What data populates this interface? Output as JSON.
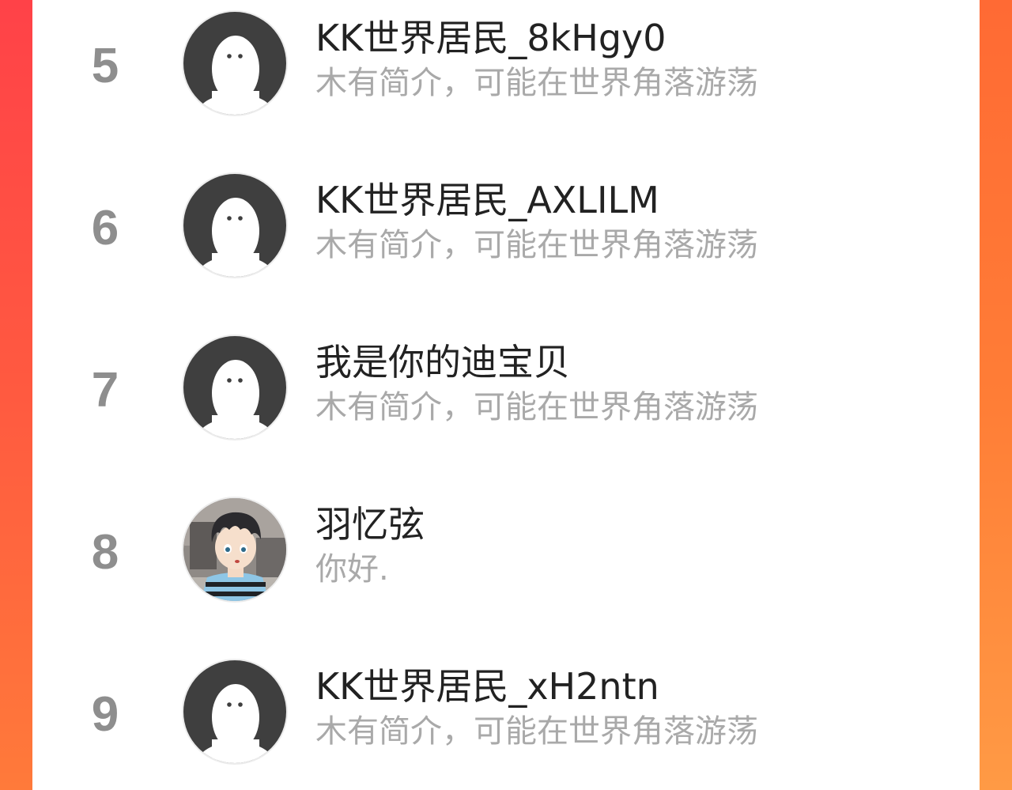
{
  "users": [
    {
      "rank": "5",
      "name": "KK世界居民_8kHgy0",
      "bio": "木有简介，可能在世界角落游荡",
      "avatar": "default-ghost-avatar"
    },
    {
      "rank": "6",
      "name": "KK世界居民_AXLILM",
      "bio": "木有简介，可能在世界角落游荡",
      "avatar": "default-ghost-avatar"
    },
    {
      "rank": "7",
      "name": "我是你的迪宝贝",
      "bio": "木有简介，可能在世界角落游荡",
      "avatar": "default-ghost-avatar"
    },
    {
      "rank": "8",
      "name": "羽忆弦",
      "bio": "你好.",
      "avatar": "anime-boy-avatar"
    },
    {
      "rank": "9",
      "name": "KK世界居民_xH2ntn",
      "bio": "木有简介，可能在世界角落游荡",
      "avatar": "default-ghost-avatar"
    }
  ],
  "colors": {
    "background_gradient_top": "#ff4a4a",
    "background_gradient_bottom": "#ff8c3a",
    "panel": "#ffffff",
    "rank_number": "#8e8e8e",
    "name_text": "#222222",
    "bio_text": "#a9a9a9",
    "default_avatar_bg": "#3f3f3f"
  }
}
